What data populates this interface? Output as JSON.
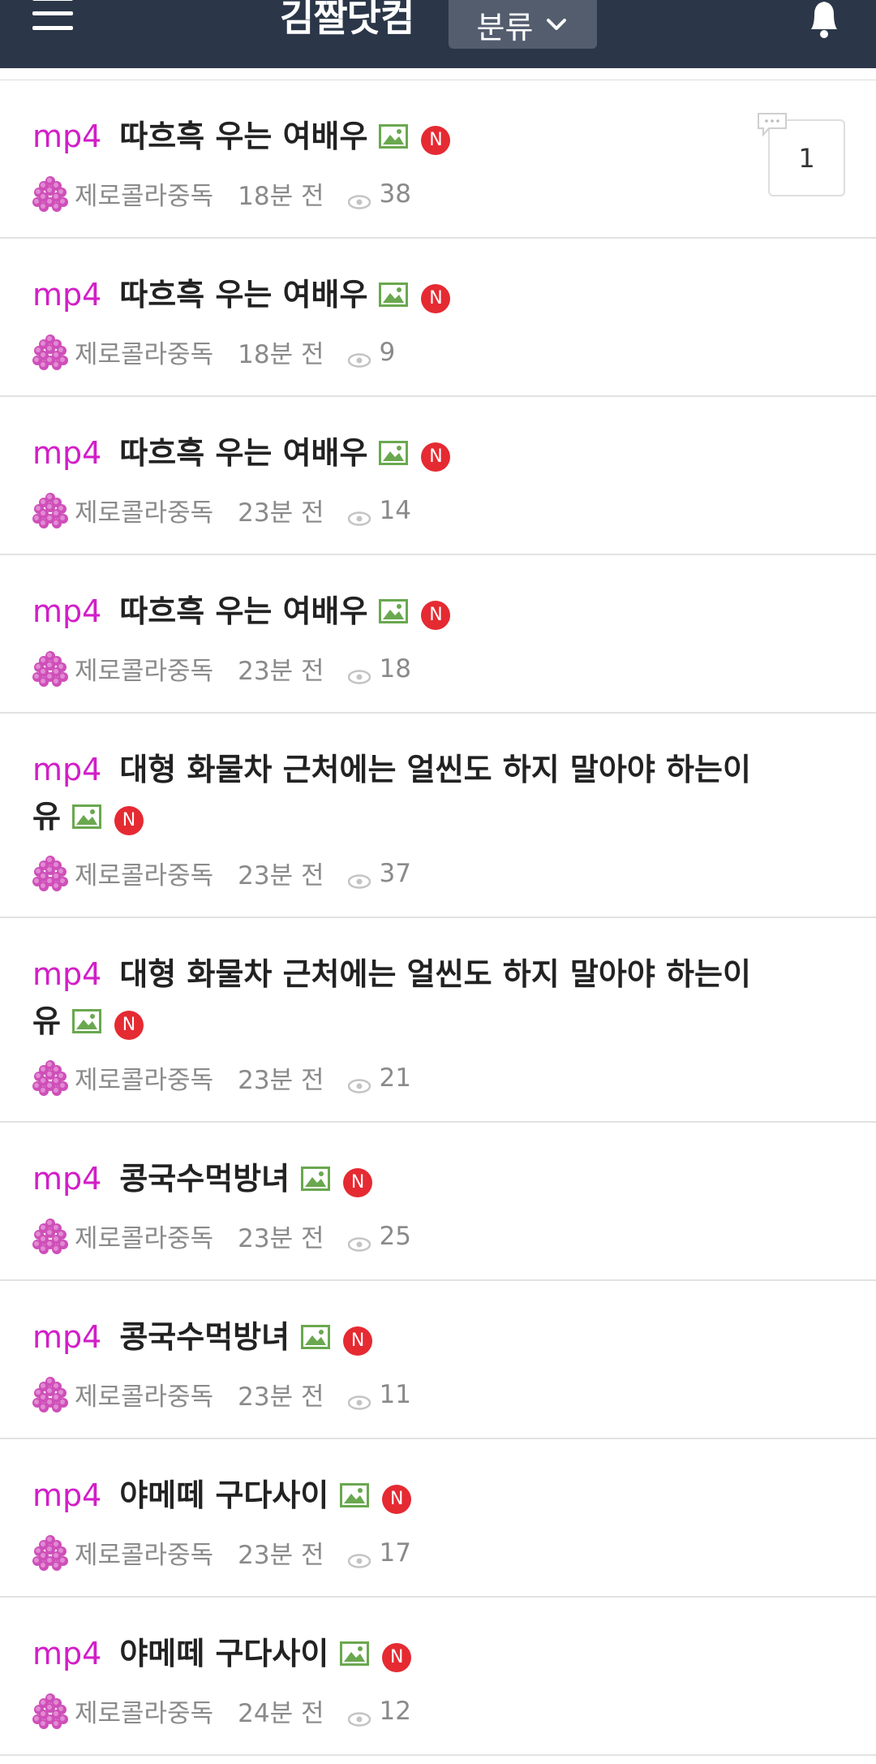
{
  "header": {
    "site_title": "김짤닷컴",
    "category_label": "분류",
    "menu_icon": "hamburger-icon",
    "category_icon": "chevron-down-icon",
    "bell_icon": "bell-icon",
    "bg_color": "#2b3648"
  },
  "colors": {
    "tag": "#d21ec8",
    "badge": "#e52a32",
    "image_icon": "#6aa84f"
  },
  "posts": [
    {
      "tag": "mp4",
      "title": "따흐흑 우는 여배우",
      "new": "N",
      "author": "제로콜라중독",
      "time": "18분 전",
      "views": "38",
      "comments": "1"
    },
    {
      "tag": "mp4",
      "title": "따흐흑 우는 여배우",
      "new": "N",
      "author": "제로콜라중독",
      "time": "18분 전",
      "views": "9"
    },
    {
      "tag": "mp4",
      "title": "따흐흑 우는 여배우",
      "new": "N",
      "author": "제로콜라중독",
      "time": "23분 전",
      "views": "14"
    },
    {
      "tag": "mp4",
      "title": "따흐흑 우는 여배우",
      "new": "N",
      "author": "제로콜라중독",
      "time": "23분 전",
      "views": "18"
    },
    {
      "tag": "mp4",
      "title": "대형 화물차 근처에는 얼씬도 하지 말아야 하는이유",
      "new": "N",
      "author": "제로콜라중독",
      "time": "23분 전",
      "views": "37"
    },
    {
      "tag": "mp4",
      "title": "대형 화물차 근처에는 얼씬도 하지 말아야 하는이유",
      "new": "N",
      "author": "제로콜라중독",
      "time": "23분 전",
      "views": "21"
    },
    {
      "tag": "mp4",
      "title": "콩국수먹방녀",
      "new": "N",
      "author": "제로콜라중독",
      "time": "23분 전",
      "views": "25"
    },
    {
      "tag": "mp4",
      "title": "콩국수먹방녀",
      "new": "N",
      "author": "제로콜라중독",
      "time": "23분 전",
      "views": "11"
    },
    {
      "tag": "mp4",
      "title": "야메떼 구다사이",
      "new": "N",
      "author": "제로콜라중독",
      "time": "23분 전",
      "views": "17"
    },
    {
      "tag": "mp4",
      "title": "야메떼 구다사이",
      "new": "N",
      "author": "제로콜라중독",
      "time": "24분 전",
      "views": "12"
    }
  ]
}
